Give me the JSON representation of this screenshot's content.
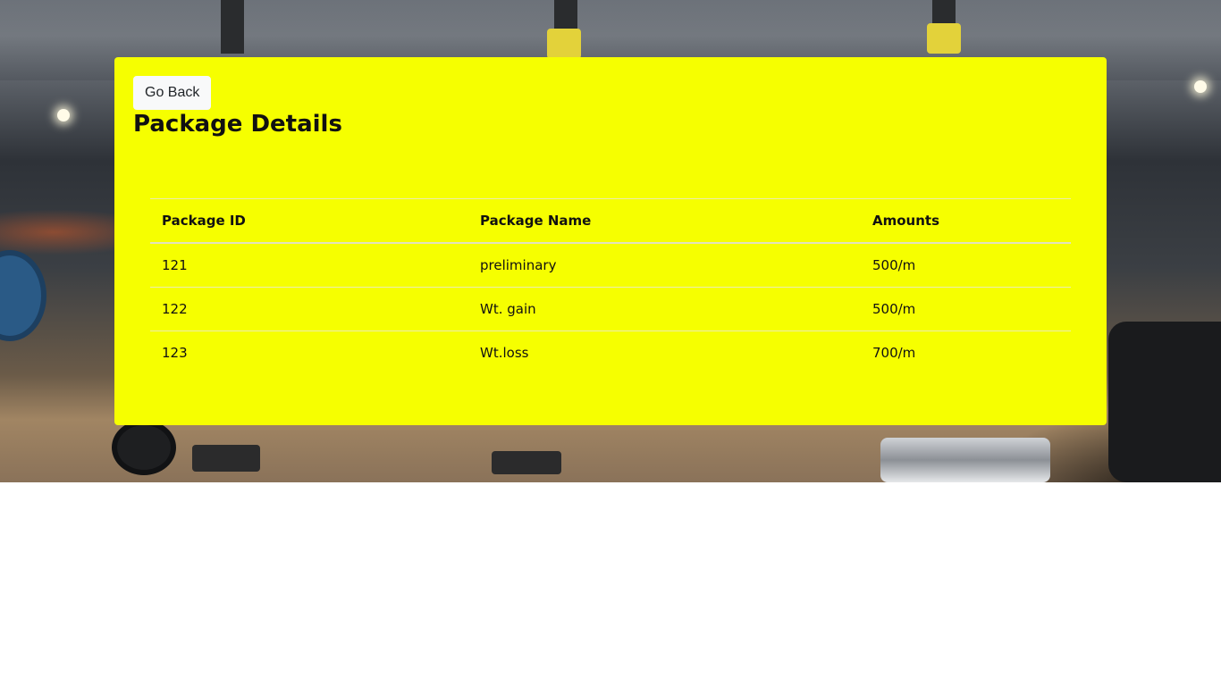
{
  "back_button": {
    "label": "Go Back"
  },
  "page": {
    "title": "Package Details"
  },
  "table": {
    "headers": [
      "Package ID",
      "Package Name",
      "Amounts"
    ],
    "rows": [
      [
        "121",
        "preliminary",
        "500/m"
      ],
      [
        "122",
        "Wt. gain",
        "500/m"
      ],
      [
        "123",
        "Wt.loss",
        "700/m"
      ]
    ]
  },
  "colors": {
    "card_background": "#f6ff00",
    "button_background": "#f8f9fa",
    "page_background": "#ffffff"
  }
}
